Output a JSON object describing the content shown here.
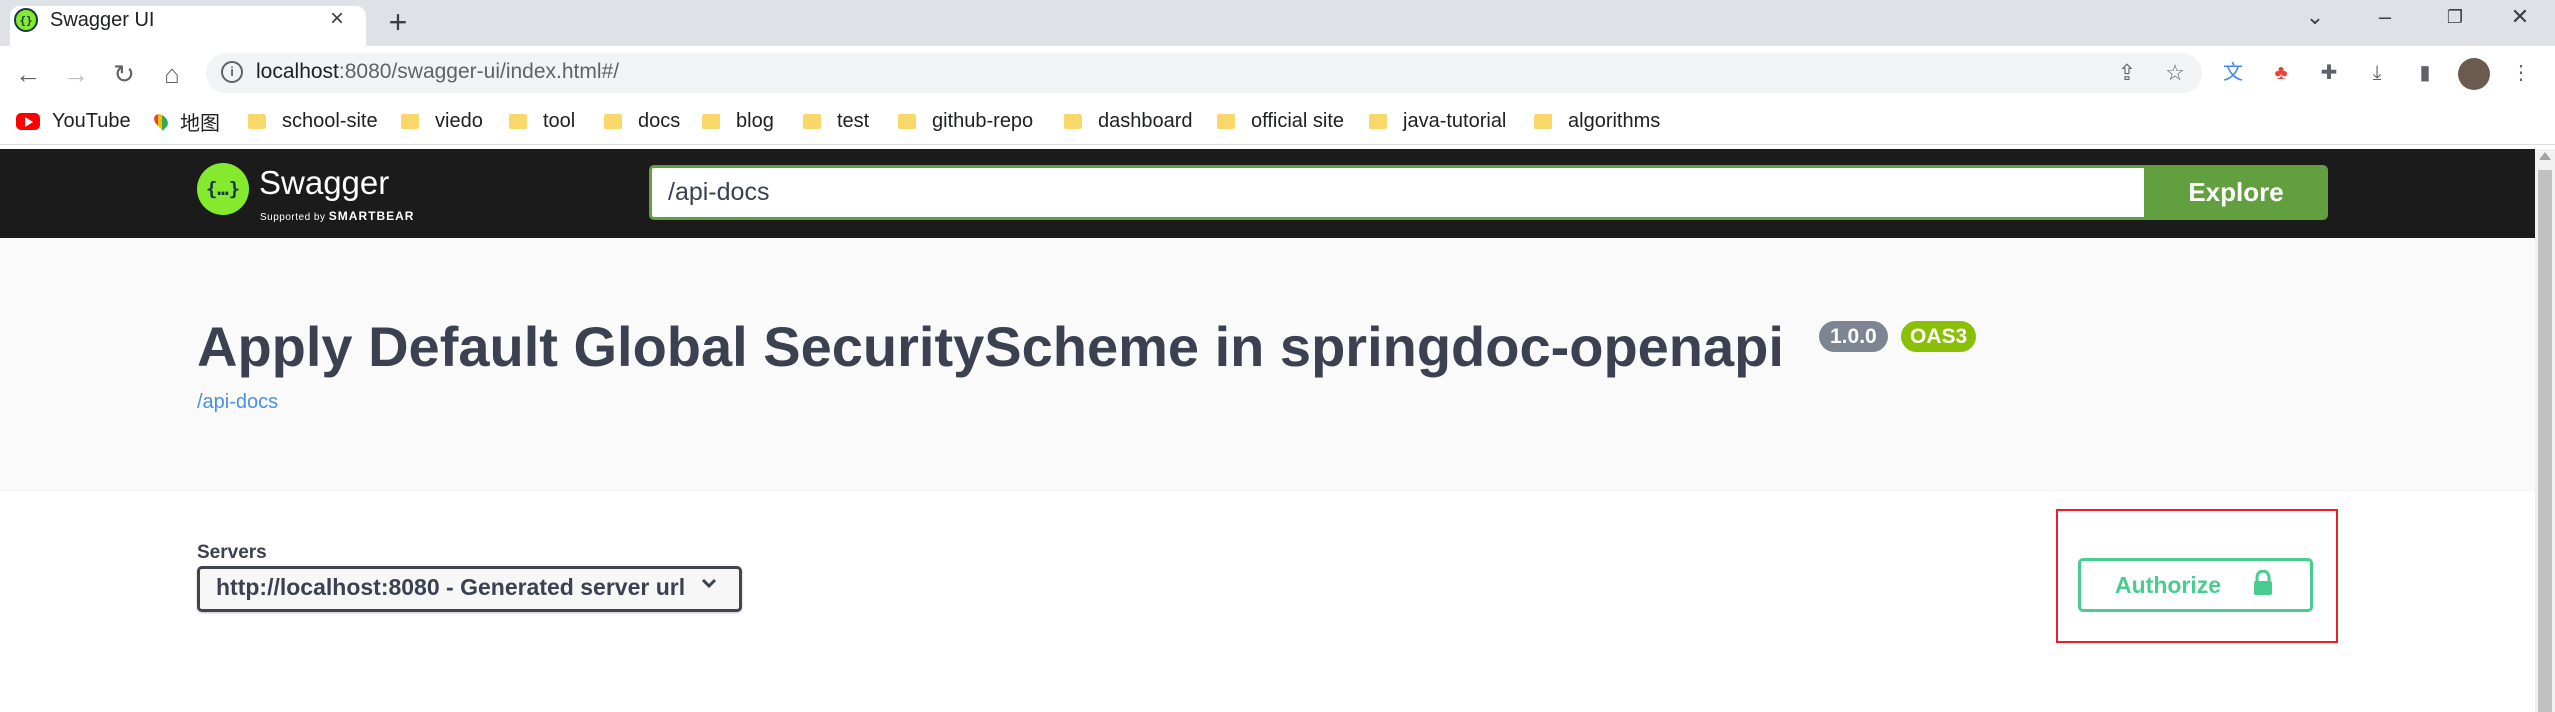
{
  "browser": {
    "tab_title": "Swagger UI",
    "url_host": "localhost",
    "url_rest": ":8080/swagger-ui/index.html#/",
    "bookmarks": [
      "YouTube",
      "地图",
      "school-site",
      "viedo",
      "tool",
      "docs",
      "blog",
      "test",
      "github-repo",
      "dashboard",
      "official site",
      "java-tutorial",
      "algorithms"
    ]
  },
  "swagger": {
    "logo_text": "Swagger",
    "logo_supported": "Supported by",
    "logo_smartbear": "SMARTBEAR",
    "url_value": "/api-docs",
    "explore_label": "Explore",
    "title": "Apply Default Global SecurityScheme in springdoc-openapi",
    "version": "1.0.0",
    "oas": "OAS3",
    "docs_link": "/api-docs",
    "servers_label": "Servers",
    "server_value": "http://localhost:8080 - Generated server url",
    "authorize_label": "Authorize"
  }
}
